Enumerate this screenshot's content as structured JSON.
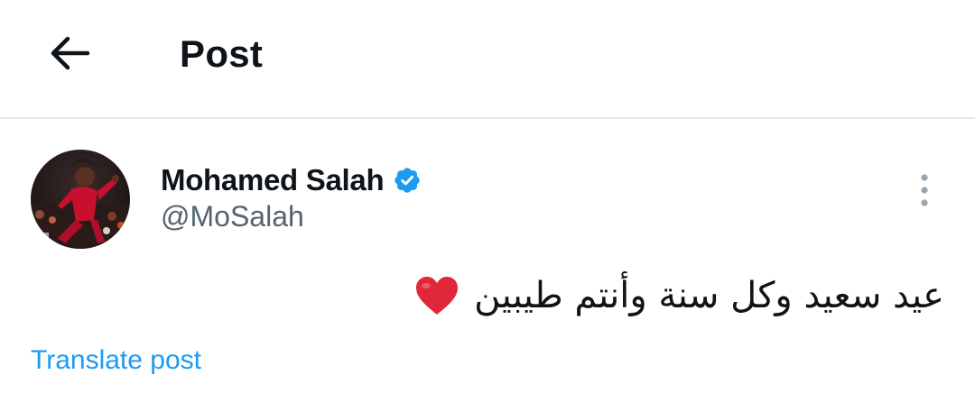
{
  "header": {
    "back_icon": "arrow-left-icon",
    "title": "Post"
  },
  "post": {
    "author": {
      "display_name": "Mohamed Salah",
      "handle": "@MoSalah",
      "verified": true,
      "verified_icon": "verified-badge-icon",
      "verified_color": "#1d9bf0"
    },
    "more_icon": "more-vertical-icon",
    "text": "عيد سعيد وكل سنة وأنتم طيبين",
    "emoji": "❤️",
    "emoji_icon": "red-heart-icon",
    "translate_label": "Translate post"
  },
  "colors": {
    "accent": "#1d9bf0",
    "text_primary": "#0f1419",
    "text_secondary": "#536471",
    "divider": "#e6e9eb"
  }
}
